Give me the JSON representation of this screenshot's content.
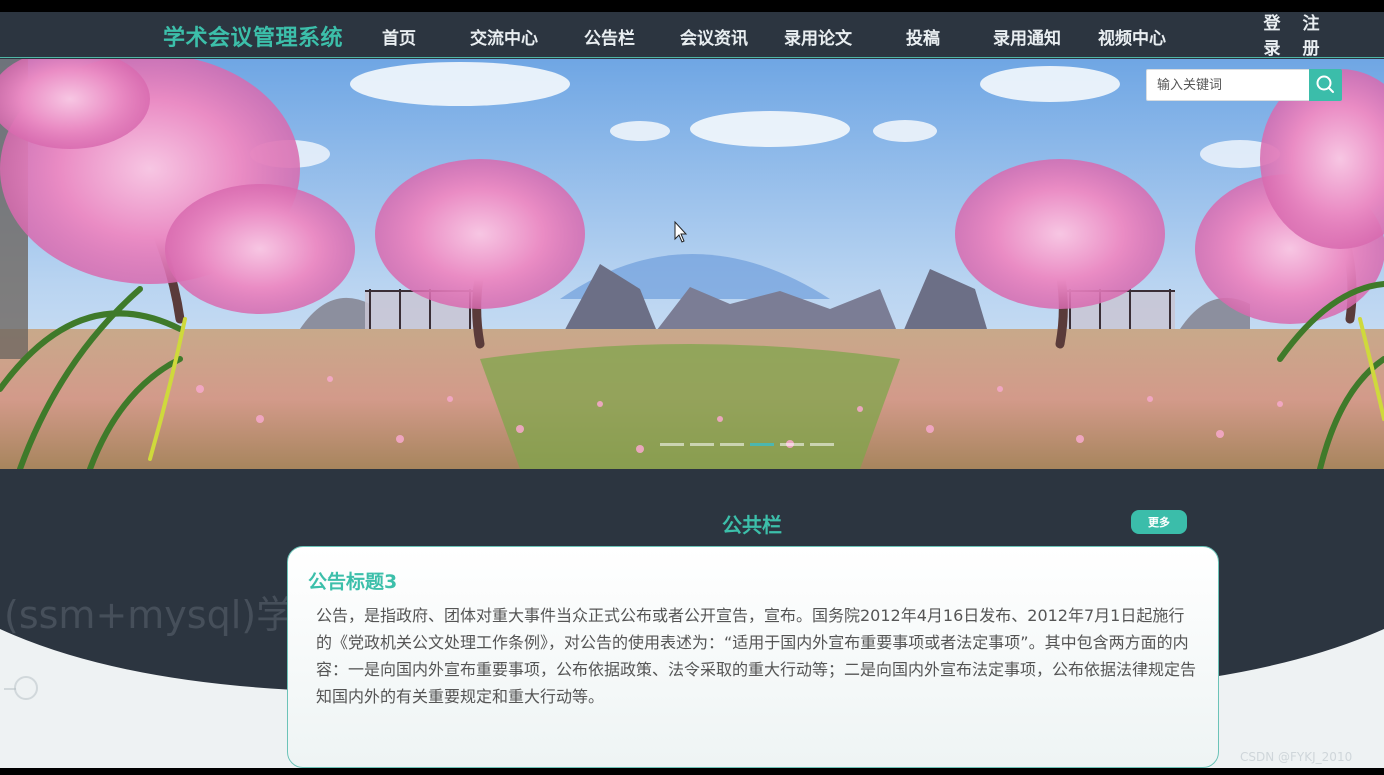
{
  "nav": {
    "brand": "学术会议管理系统",
    "items": [
      {
        "label": "首页"
      },
      {
        "label": "交流中心"
      },
      {
        "label": "公告栏"
      },
      {
        "label": "会议资讯"
      },
      {
        "label": "录用论文"
      },
      {
        "label": "投稿"
      },
      {
        "label": "录用通知"
      },
      {
        "label": "视频中心"
      }
    ],
    "login": [
      "登",
      "录"
    ],
    "register": [
      "注",
      "册"
    ]
  },
  "search": {
    "placeholder": "输入关键词",
    "icon": "search-icon"
  },
  "carousel": {
    "slides": 6,
    "active_index": 3
  },
  "notice": {
    "section_title": "公共栏",
    "more_label": "更多",
    "title": "公告标题3",
    "body": "公告，是指政府、团体对重大事件当众正式公布或者公开宣告，宣布。国务院2012年4月16日发布、2012年7月1日起施行的《党政机关公文处理工作条例》，对公告的使用表述为：“适用于国内外宣布重要事项或者法定事项”。其中包含两方面的内容：一是向国内外宣布重要事项，公布依据政策、法令采取的重大行动等；二是向国内外宣布法定事项，公布依据法律规定告知国内外的有关重要规定和重大行动等。"
  },
  "watermark": "(ssm+mysql)学术",
  "credit": "CSDN @FYKJ_2010",
  "colors": {
    "accent": "#3cbfaa",
    "nav_bg": "#2c3540",
    "text": "#e9eef1"
  }
}
